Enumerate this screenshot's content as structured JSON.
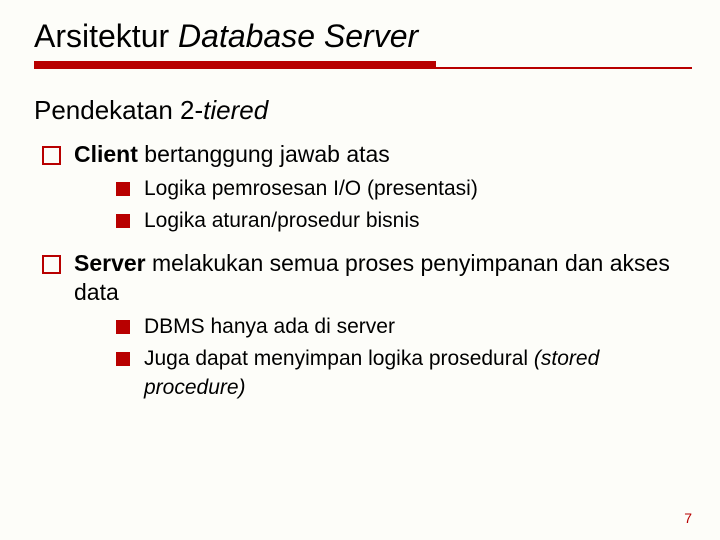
{
  "title": {
    "plain": "Arsitektur ",
    "italic": "Database Server"
  },
  "subtitle": {
    "plain": "Pendekatan 2-",
    "italic": "tiered"
  },
  "bullets": [
    {
      "bold": "Client",
      "rest": " bertanggung jawab atas",
      "sub": [
        "Logika pemrosesan I/O (presentasi)",
        "Logika aturan/prosedur bisnis"
      ]
    },
    {
      "bold": "Server",
      "rest": " melakukan semua proses penyimpanan dan akses data",
      "sub": [
        "DBMS hanya ada di server",
        "Juga dapat menyimpan logika prosedural (stored procedure)"
      ]
    }
  ],
  "pageNumber": "7"
}
